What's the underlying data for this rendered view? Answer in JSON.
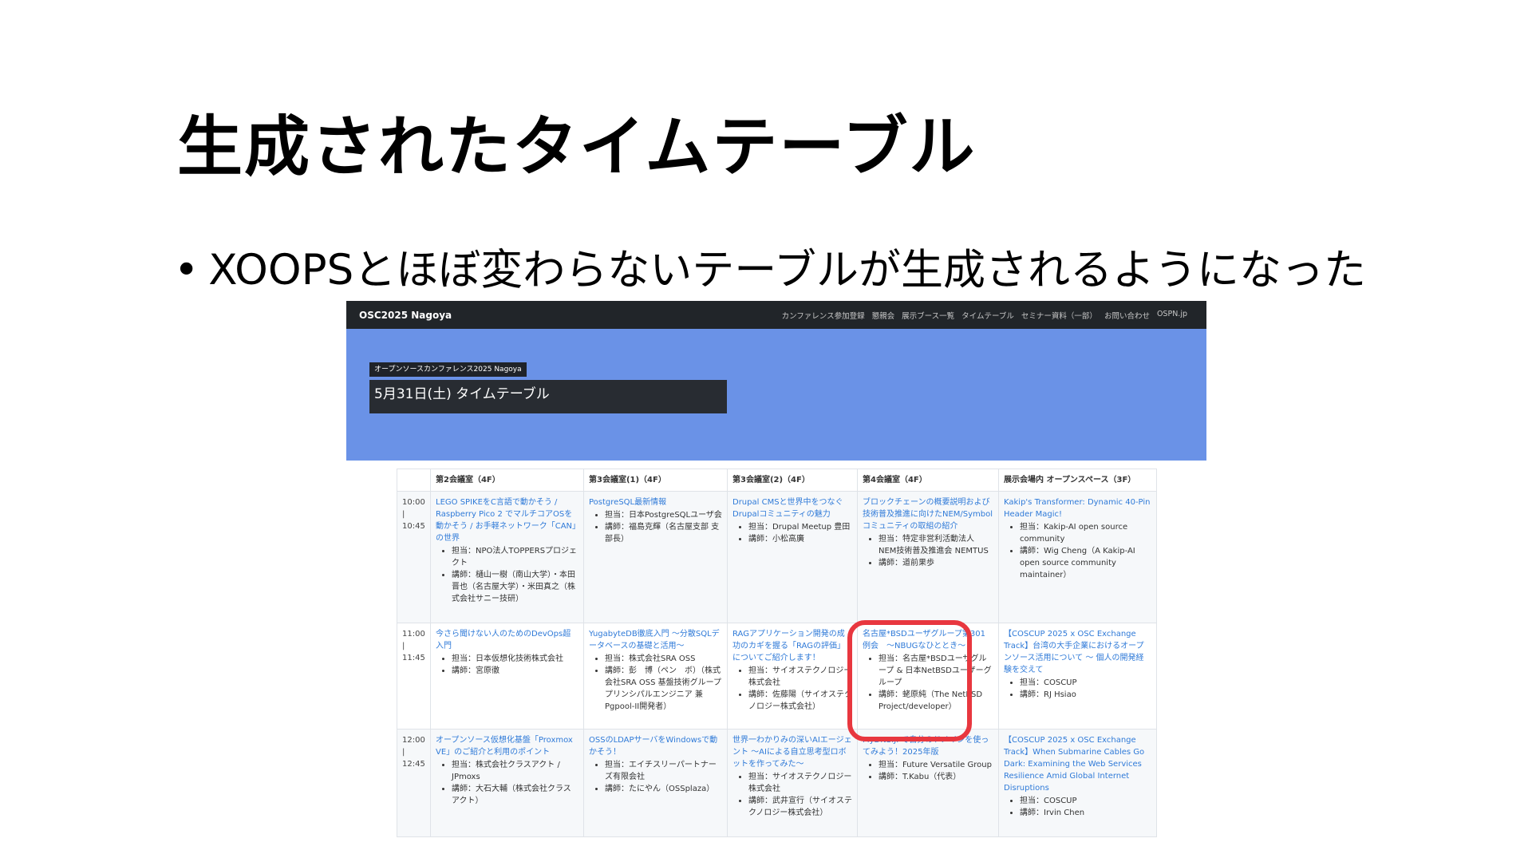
{
  "slide": {
    "title": "生成されたタイムテーブル",
    "bullet": "XOOPSとほぼ変わらないテーブルが生成されるようになった"
  },
  "site": {
    "brand": "OSC2025 Nagoya",
    "nav": [
      "カンファレンス参加登録",
      "懇親会",
      "展示ブース一覧",
      "タイムテーブル",
      "セミナー資料（一部）",
      "お問い合わせ",
      "OSPN.jp"
    ],
    "event_badge": "オープンソースカンファレンス2025 Nagoya",
    "page_heading": "5月31日(土) タイムテーブル"
  },
  "timetable": {
    "rooms": [
      "第2会議室（4F）",
      "第3会議室(1)（4F）",
      "第3会議室(2)（4F）",
      "第4会議室（4F）",
      "展示会場内 オープンスペース（3F）"
    ],
    "rows": [
      {
        "start": "10:00",
        "sep": "|",
        "end": "10:45",
        "cells": [
          {
            "title": "LEGO SPIKEをC言語で動かそう / Raspberry Pico 2 でマルチコアOSを動かそう / お手軽ネットワーク「CAN」の世界",
            "details": [
              "担当：NPO法人TOPPERSプロジェクト",
              "講師：樋山一樹（南山大学）・本田晋也（名古屋大学）・米田真之（株式会社サニー技研）"
            ]
          },
          {
            "title": "PostgreSQL最新情報",
            "details": [
              "担当：日本PostgreSQLユーザ会",
              "講師：福島克輝（名古屋支部 支部長）"
            ]
          },
          {
            "title": "Drupal CMSと世界中をつなぐDrupalコミュニティの魅力",
            "details": [
              "担当：Drupal Meetup 豊田",
              "講師：小松高廣"
            ]
          },
          {
            "title": "ブロックチェーンの概要説明および技術普及推進に向けたNEM/Symbolコミュニティの取組の紹介",
            "details": [
              "担当：特定非営利活動法人 NEM技術普及推進会 NEMTUS",
              "講師：道前果歩"
            ]
          },
          {
            "title": "Kakip's Transformer: Dynamic 40-Pin Header Magic!",
            "details": [
              "担当：Kakip-AI open source community",
              "講師：Wig Cheng（A Kakip-AI open source community maintainer）"
            ]
          }
        ]
      },
      {
        "start": "11:00",
        "sep": "|",
        "end": "11:45",
        "cells": [
          {
            "title": "今さら聞けない人のためのDevOps超入門",
            "details": [
              "担当：日本仮想化技術株式会社",
              "講師：宮原徹"
            ]
          },
          {
            "title": "YugabyteDB徹底入門 〜分散SQLデータベースの基礎と活用〜",
            "details": [
              "担当：株式会社SRA OSS",
              "講師：彭　博（ペン　ボ）（株式会社SRA OSS 基盤技術グループ　プリンシパルエンジニア 兼 Pgpool-II開発者）"
            ]
          },
          {
            "title": "RAGアプリケーション開発の成功のカギを握る「RAGの評価」についてご紹介します！",
            "details": [
              "担当：サイオステクノロジー株式会社",
              "講師：佐藤陽（サイオステクノロジー株式会社）"
            ]
          },
          {
            "title": "名古屋*BSDユーザグループ第301例会　〜NBUGなひととき〜",
            "details": [
              "担当：名古屋*BSDユーザグループ & 日本NetBSDユーザーグループ",
              "講師：蛯原純（The NetBSD Project/developer）"
            ]
          },
          {
            "title": "【COSCUP 2025 x OSC Exchange Track】台湾の大手企業におけるオープンソース活用について 〜 個人の開発経験を交えて",
            "details": [
              "担当：COSCUP",
              "講師：RJ Hsiao"
            ]
          }
        ]
      },
      {
        "start": "12:00",
        "sep": "|",
        "end": "12:45",
        "cells": [
          {
            "title": "オープンソース仮想化基盤「Proxmox VE」のご紹介と利用のポイント",
            "details": [
              "担当：株式会社クラスアクト / JPmoxs",
              "講師：大石大輔（株式会社クラスアクト）"
            ]
          },
          {
            "title": "OSSのLDAPサーバをWindowsで動かそう！",
            "details": [
              "担当：エイチスリーパートナーズ有限会社",
              "講師：たにやん（OSSplaza）"
            ]
          },
          {
            "title": "世界一わかりみの深いAIエージェント 〜AIによる自立思考型ロボットを作ってみた〜",
            "details": [
              "担当：サイオステクノロジー株式会社",
              "講師：武井宣行（サイオステクノロジー株式会社）"
            ]
          },
          {
            "title": "MyDNS.JPで自分のドメインを使ってみよう！2025年版",
            "details": [
              "担当：Future Versatile Group",
              "講師：T.Kabu（代表）"
            ]
          },
          {
            "title": "【COSCUP 2025 x OSC Exchange Track】When Submarine Cables Go Dark: Examining the Web Services Resilience Amid Global Internet Disruptions",
            "details": [
              "担当：COSCUP",
              "講師：Irvin Chen"
            ]
          }
        ]
      }
    ]
  },
  "colors": {
    "highlight": "#e8373f",
    "hero": "#6a92e7",
    "navbar": "#212529",
    "link": "#2f7ad8"
  }
}
